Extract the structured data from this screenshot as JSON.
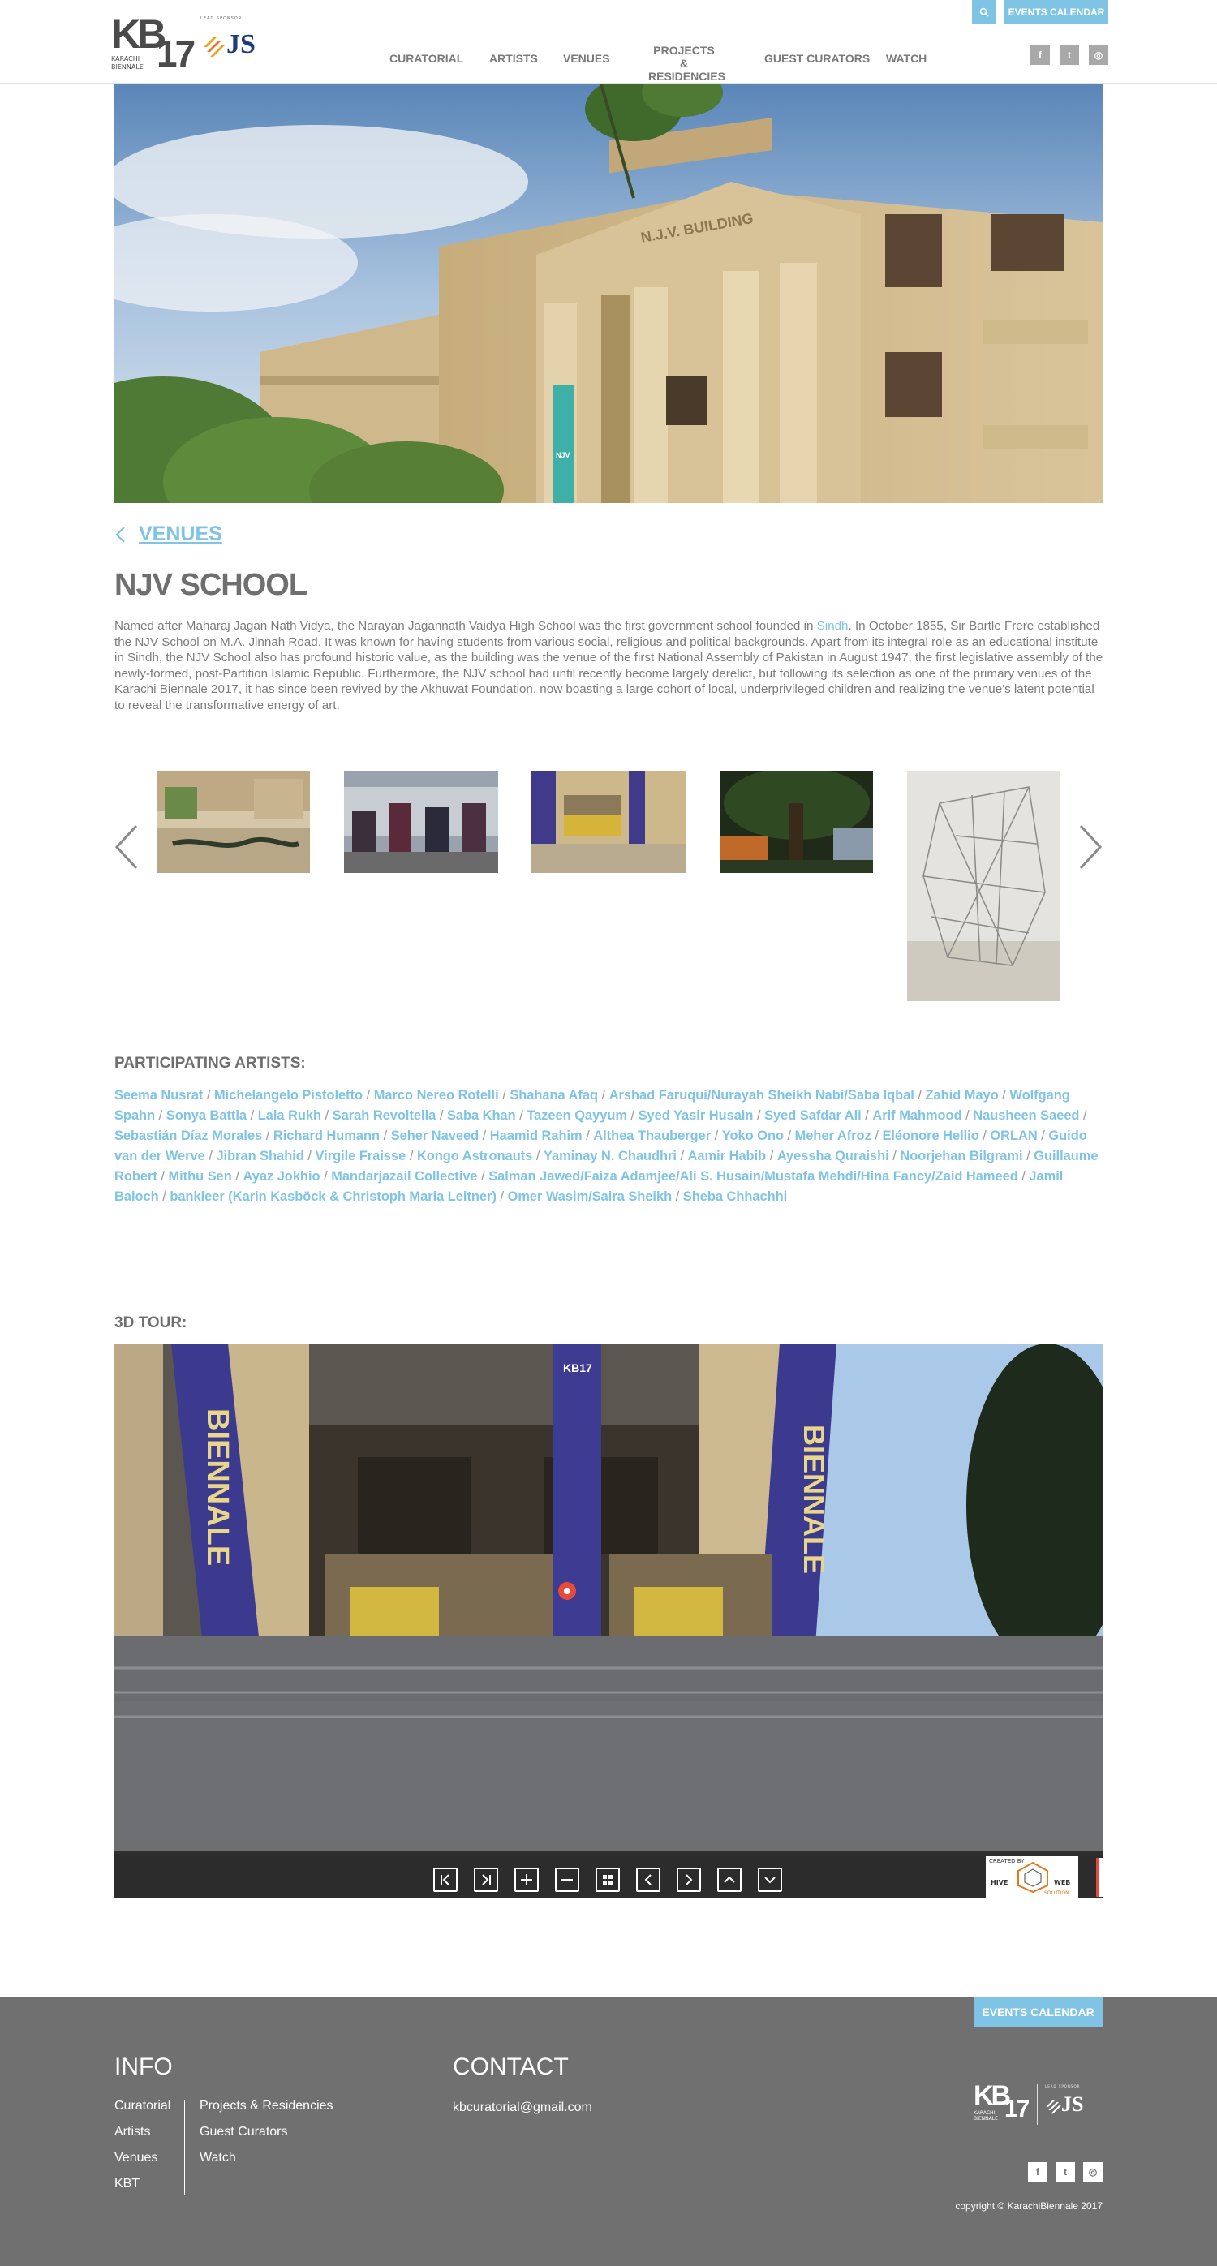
{
  "header": {
    "search_icon": "search-icon",
    "events_calendar": "EVENTS CALENDAR",
    "logo": {
      "kb": "KB",
      "year": "17",
      "sub1": "KARACHI",
      "sub2": "BIENNALE",
      "sponsor": "LEAD SPONSOR",
      "js": "JS"
    },
    "nav": [
      "CURATORIAL",
      "ARTISTS",
      "VENUES",
      "PROJECTS &",
      "RESIDENCIES",
      "GUEST CURATORS",
      "WATCH"
    ],
    "social": [
      "f",
      "t",
      "◎"
    ]
  },
  "venue": {
    "back_label": "VENUES",
    "title": "NJV SCHOOL",
    "desc_1": "Named after Maharaj Jagan Nath Vidya, the Narayan Jagannath Vaidya High School was the first government school founded in ",
    "desc_link": "Sindh",
    "desc_2": ". In October 1855, Sir Bartle Frere established the NJV School on M.A. Jinnah Road. It was known for having students from various social, religious and political backgrounds. Apart from its integral role as an educational institute in Sindh, the NJV School also has profound historic value, as the building was the venue of the first National Assembly of Pakistan in August 1947, the first legislative assembly of the newly-formed, post-Partition Islamic Republic. Furthermore, the NJV school had until recently become largely derelict, but following its selection as one of the primary venues of the Karachi Biennale 2017, it has since been revived by the Akhuwat Foundation, now boasting a large cohort of local, underprivileged children and realizing the venue's latent potential to reveal the transformative energy of art."
  },
  "artists": {
    "heading": "PARTICIPATING ARTISTS:",
    "names": [
      "Seema Nusrat",
      "Michelangelo Pistoletto",
      "Marco Nereo Rotelli",
      "Shahana Afaq",
      "Arshad Faruqui/Nurayah Sheikh Nabi/Saba Iqbal",
      "Zahid Mayo",
      "Wolfgang Spahn",
      "Sonya Battla",
      "Lala Rukh",
      "Sarah Revoltella",
      "Saba Khan",
      "Tazeen Qayyum",
      "Syed Yasir Husain",
      "Syed Safdar Ali",
      "Arif Mahmood",
      "Nausheen Saeed",
      "Sebastián Díaz Morales",
      "Richard Humann",
      "Seher Naveed",
      "Haamid Rahim",
      "Althea Thauberger",
      "Yoko Ono",
      "Meher Afroz",
      "Eléonore Hellio",
      "ORLAN",
      "Guido van der Werve",
      "Jibran Shahid",
      "Virgile Fraisse",
      "Kongo Astronauts",
      "Yaminay N. Chaudhri",
      "Aamir Habib",
      "Ayessha Quraishi",
      "Noorjehan Bilgrami",
      "Guillaume Robert",
      "Mithu Sen",
      "Ayaz Jokhio",
      "Mandarjazail Collective",
      "Salman Jawed/Faiza Adamjee/Ali S. Husain/Mustafa Mehdi/Hina Fancy/Zaid Hameed",
      "Jamil Baloch",
      "bankleer (Karin Kasböck & Christoph Maria Leitner)",
      "Omer Wasim/Saira Sheikh",
      "Sheba Chhachhi"
    ],
    "separator": " / "
  },
  "tour": {
    "heading": "3D TOUR:",
    "controls": [
      "first-icon",
      "last-icon",
      "zoom-in-icon",
      "zoom-out-icon",
      "grid-icon",
      "left-icon",
      "right-icon",
      "up-icon",
      "down-icon"
    ],
    "credit_top": "CREATED BY",
    "credit_left": "HIVE",
    "credit_right": "WEB",
    "credit_bottom": "SOLUTION",
    "banner_left": "BIENNALE",
    "banner_right": "BIENNALE",
    "banner_center": "KB17"
  },
  "footer": {
    "events_calendar": "EVENTS CALENDAR",
    "info_heading": "INFO",
    "contact_heading": "CONTACT",
    "info_col1": [
      "Curatorial",
      "Artists",
      "Venues",
      "KBT"
    ],
    "info_col2": [
      "Projects & Residencies",
      "Guest Curators",
      "Watch"
    ],
    "email": "kbcuratorial@gmail.com",
    "copyright": "copyright © KarachiBiennale 2017",
    "social": [
      "f",
      "t",
      "◎"
    ]
  },
  "colors": {
    "accent": "#7fc4e5",
    "footer_bg": "#707070",
    "text": "#6f6f6f"
  }
}
